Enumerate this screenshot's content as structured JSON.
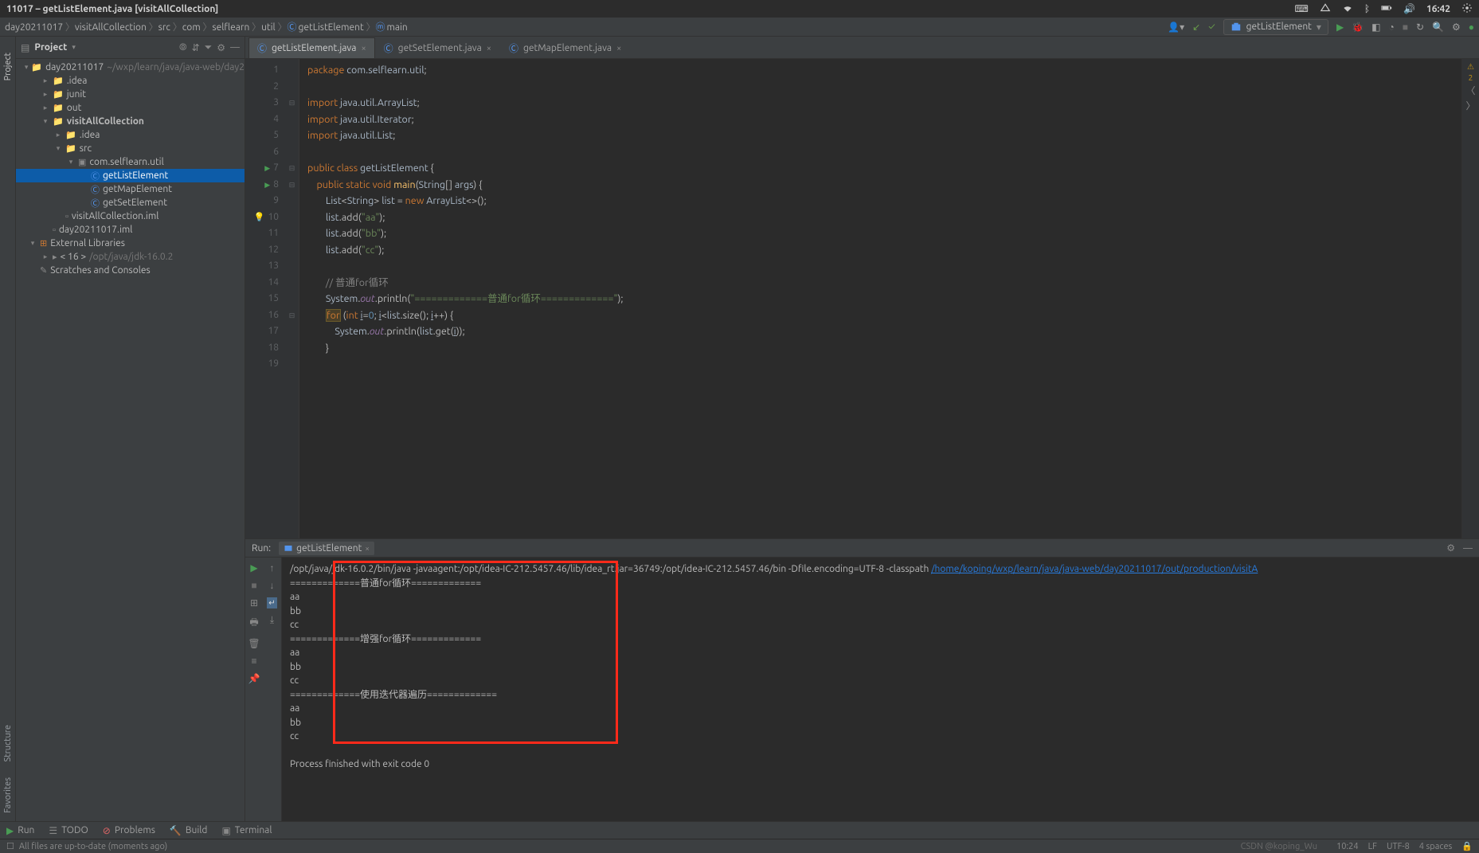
{
  "system": {
    "title": "11017 – getListElement.java [visitAllCollection]",
    "clock": "16:42"
  },
  "breadcrumbs": [
    "day20211017",
    "visitAllCollection",
    "src",
    "com",
    "selflearn",
    "util",
    "getListElement",
    "main"
  ],
  "toolbar": {
    "run_config": "getListElement"
  },
  "project_panel": {
    "title": "Project",
    "items": [
      {
        "depth": 0,
        "arrow": "▾",
        "icon": "module",
        "label": "day20211017",
        "dim": "~/wxp/learn/java/java-web/day2"
      },
      {
        "depth": 1,
        "arrow": "▸",
        "icon": "folder",
        "label": ".idea"
      },
      {
        "depth": 1,
        "arrow": "▸",
        "icon": "folder",
        "label": "junit"
      },
      {
        "depth": 1,
        "arrow": "▸",
        "icon": "folder-out",
        "label": "out"
      },
      {
        "depth": 1,
        "arrow": "▾",
        "icon": "folder-out",
        "label": "visitAllCollection",
        "bold": true
      },
      {
        "depth": 2,
        "arrow": "▸",
        "icon": "folder",
        "label": ".idea"
      },
      {
        "depth": 2,
        "arrow": "▾",
        "icon": "folder-src",
        "label": "src"
      },
      {
        "depth": 3,
        "arrow": "▾",
        "icon": "package",
        "label": "com.selflearn.util"
      },
      {
        "depth": 4,
        "arrow": "",
        "icon": "class",
        "label": "getListElement",
        "sel": true
      },
      {
        "depth": 4,
        "arrow": "",
        "icon": "class",
        "label": "getMapElement"
      },
      {
        "depth": 4,
        "arrow": "",
        "icon": "class",
        "label": "getSetElement"
      },
      {
        "depth": 2,
        "arrow": "",
        "icon": "iml",
        "label": "visitAllCollection.iml"
      },
      {
        "depth": 1,
        "arrow": "",
        "icon": "iml",
        "label": "day20211017.iml"
      },
      {
        "depth": 0,
        "arrow": "▾",
        "icon": "lib",
        "label": "External Libraries"
      },
      {
        "depth": 1,
        "arrow": "▸",
        "icon": "jdk",
        "label": "< 16 >",
        "dim": "/opt/java/jdk-16.0.2"
      },
      {
        "depth": 0,
        "arrow": "",
        "icon": "scratch",
        "label": "Scratches and Consoles"
      }
    ]
  },
  "tabs": [
    {
      "label": "getListElement.java",
      "active": true
    },
    {
      "label": "getSetElement.java",
      "active": false
    },
    {
      "label": "getMapElement.java",
      "active": false
    }
  ],
  "editor": {
    "warnings": "2",
    "lines": [
      {
        "n": 1,
        "html": "<span class='kw'>package</span> <span class='ident'>com.selflearn.util</span>;"
      },
      {
        "n": 2,
        "html": ""
      },
      {
        "n": 3,
        "html": "<span class='kw'>import</span> <span class='ident'>java.util.ArrayList</span>;"
      },
      {
        "n": 4,
        "html": "<span class='kw'>import</span> <span class='ident'>java.util.Iterator</span>;"
      },
      {
        "n": 5,
        "html": "<span class='kw'>import</span> <span class='ident'>java.util.List</span>;"
      },
      {
        "n": 6,
        "html": ""
      },
      {
        "n": 7,
        "play": true,
        "html": "<span class='kw'>public class</span> <span class='ident'>getListElement</span> {"
      },
      {
        "n": 8,
        "play": true,
        "html": "    <span class='kw'>public static void</span> <span class='fn'>main</span>(<span class='ident'>String</span>[] <span class='par'>args</span>) {"
      },
      {
        "n": 9,
        "html": "        <span class='ident'>List</span>&lt;<span class='ident'>String</span>&gt; <span class='ident'>list</span> = <span class='kw'>new</span> <span class='ident'>ArrayList</span>&lt;&gt;();"
      },
      {
        "n": 10,
        "bulb": true,
        "html": "        <span class='ident'>list</span>.add(<span class='str'>\"aa\"</span>);"
      },
      {
        "n": 11,
        "html": "        <span class='ident'>list</span>.add(<span class='str'>\"bb\"</span>);"
      },
      {
        "n": 12,
        "html": "        <span class='ident'>list</span>.add(<span class='str'>\"cc\"</span>);"
      },
      {
        "n": 13,
        "html": ""
      },
      {
        "n": 14,
        "html": "        <span class='com'>// 普通for循环</span>"
      },
      {
        "n": 15,
        "html": "        <span class='ident'>System</span>.<span class='fld'>out</span>.println(<span class='str'>\"=============普通for循环=============\"</span>);"
      },
      {
        "n": 16,
        "html": "        <span class='kw for-hl'>for</span> (<span class='kw'>int</span> <u class='ident'>i</u>=<span class='num'>0</span>; <u class='ident'>i</u>&lt;<span class='ident'>list</span>.size(); <u class='ident'>i</u>++) {"
      },
      {
        "n": 17,
        "html": "            <span class='ident'>System</span>.<span class='fld'>out</span>.println(<span class='ident'>list</span>.get(<u class='ident'>i</u>));"
      },
      {
        "n": 18,
        "html": "        }"
      },
      {
        "n": 19,
        "html": ""
      }
    ]
  },
  "run": {
    "label": "Run:",
    "config": "getListElement",
    "cmd_prefix": "/opt/java/jdk-16.0.2/bin/java -javaagent:/opt/idea-IC-212.5457.46/lib/idea_rt.jar=36749:/opt/idea-IC-212.5457.46/bin -Dfile.encoding=UTF-8 -classpath ",
    "cmd_link": "/home/koping/wxp/learn/java/java-web/day20211017/out/production/visitA",
    "output": [
      "=============普通for循环=============",
      "aa",
      "bb",
      "cc",
      "=============增强for循环=============",
      "aa",
      "bb",
      "cc",
      "=============使用迭代器遍历=============",
      "aa",
      "bb",
      "cc",
      "",
      "Process finished with exit code 0"
    ]
  },
  "bottom": {
    "run": "Run",
    "todo": "TODO",
    "problems": "Problems",
    "build": "Build",
    "terminal": "Terminal"
  },
  "status": {
    "message": "All files are up-to-date (moments ago)",
    "watermark": "CSDN @koping_Wu",
    "pos": "10:24",
    "lf": "LF",
    "enc": "UTF-8",
    "indent": "4 spaces"
  },
  "side_labels": {
    "project": "Project",
    "structure": "Structure",
    "favorites": "Favorites"
  }
}
